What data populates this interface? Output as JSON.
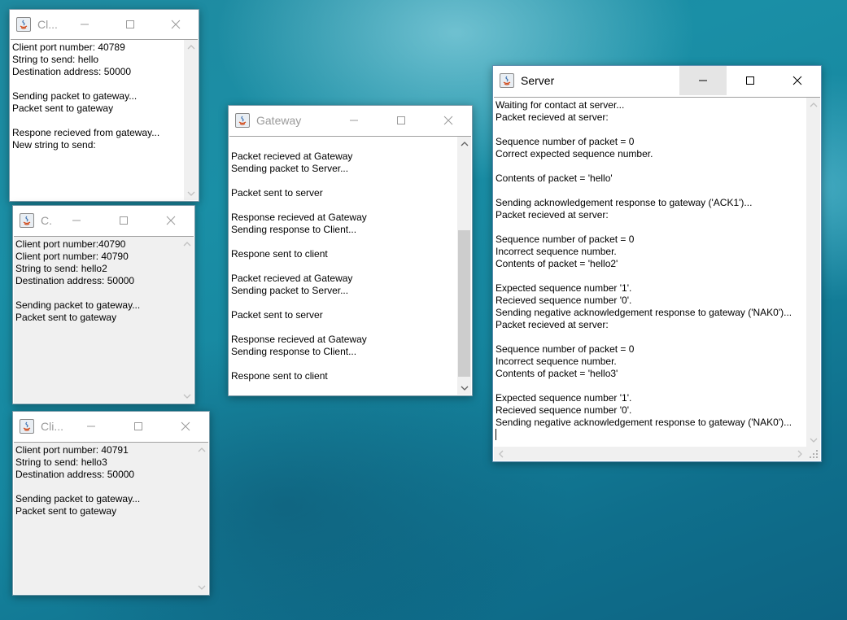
{
  "windows": {
    "client1": {
      "title": "Cl...",
      "lines": "Client port number: 40789\nString to send: hello\nDestination address: 50000\n\nSending packet to gateway...\nPacket sent to gateway\n\nRespone recieved from gateway...\nNew string to send:"
    },
    "client2": {
      "title": "C.",
      "lines": "Client port number:40790\nClient port number: 40790\nString to send: hello2\nDestination address: 50000\n\nSending packet to gateway...\nPacket sent to gateway"
    },
    "client3": {
      "title": "Cli...",
      "lines": "Client port number: 40791\nString to send: hello3\nDestination address: 50000\n\nSending packet to gateway...\nPacket sent to gateway"
    },
    "gateway": {
      "title": "Gateway",
      "lines": "\nPacket recieved at Gateway\nSending packet to Server...\n\nPacket sent to server\n\nResponse recieved at Gateway\nSending response to Client...\n\nRespone sent to client\n\nPacket recieved at Gateway\nSending packet to Server...\n\nPacket sent to server\n\nResponse recieved at Gateway\nSending response to Client...\n\nRespone sent to client"
    },
    "server": {
      "title": "Server",
      "lines": "Waiting for contact at server...\nPacket recieved at server:\n\nSequence number of packet = 0\nCorrect expected sequence number.\n\nContents of packet = 'hello'\n\nSending acknowledgement response to gateway ('ACK1')...\nPacket recieved at server:\n\nSequence number of packet = 0\nIncorrect sequence number.\nContents of packet = 'hello2'\n\nExpected sequence number '1'.\nRecieved sequence number '0'.\nSending negative acknowledgement response to gateway ('NAK0')...\nPacket recieved at server:\n\nSequence number of packet = 0\nIncorrect sequence number.\nContents of packet = 'hello3'\n\nExpected sequence number '1'.\nRecieved sequence number '0'.\nSending negative acknowledgement response to gateway ('NAK0')..."
    }
  },
  "gateway_scroll": {
    "position_fraction": 0.6
  },
  "colors": {
    "window_bg": "#ffffff",
    "disabled_bg": "#f0f0f0",
    "thumb": "#cdcdcd"
  }
}
